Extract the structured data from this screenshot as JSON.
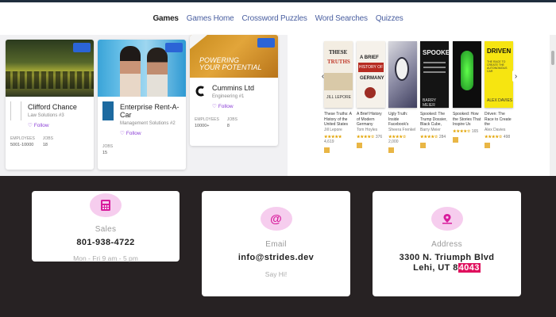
{
  "nav": {
    "items": [
      "Games",
      "Games Home",
      "Crossword Puzzles",
      "Word Searches",
      "Quizzes"
    ]
  },
  "jobs": [
    {
      "name": "Clifford Chance",
      "sub": "Law Solutions #3",
      "follow": "Follow",
      "stat1_label": "EMPLOYEES",
      "stat1_value": "5001-10000",
      "stat2_label": "JOBS",
      "stat2_value": "18"
    },
    {
      "name": "Enterprise Rent-A-Car",
      "sub": "Management Solutions #2",
      "follow": "Follow",
      "stat1_label": "JOBS",
      "stat1_value": "15"
    },
    {
      "name": "Cummins Ltd",
      "sub": "Engineering #1",
      "follow": "Follow",
      "stat1_label": "EMPLOYEES",
      "stat1_value": "10000+",
      "stat2_label": "JOBS",
      "stat2_value": "8",
      "banner_line1": "POWERING",
      "banner_line2": "YOUR POTENTIAL"
    }
  ],
  "books": [
    {
      "title": "These Truths: A History of the United States",
      "author": "Jill Lepore",
      "rating": "★★★★★",
      "count": "4,619"
    },
    {
      "title": "A Brief History of Modern Germany",
      "author": "Tom Hoyles",
      "rating": "★★★★☆",
      "count": "376"
    },
    {
      "title": "Ugly Truth: Inside Facebook's Battle for Domination",
      "author": "Sheera Frenkel",
      "rating": "★★★★☆",
      "count": "2,000"
    },
    {
      "title": "Spooked: The Trump Dossier, Black Cube, and the Rise of Private Spies",
      "author": "Barry Meier",
      "rating": "★★★★☆",
      "count": "284"
    },
    {
      "title": "Spooked: How the Stories That Inspire Us",
      "author": "",
      "rating": "★★★★☆",
      "count": "165"
    },
    {
      "title": "Driven: The Race to Create the Autonomous Car",
      "author": "Alex Davies",
      "rating": "★★★★☆",
      "count": "498"
    }
  ],
  "book_covers": [
    {
      "line1": "THESE",
      "line2": "TRUTHS",
      "line3": "JILL LEPORE"
    },
    {
      "line1": "A BRIEF",
      "line2": "HISTORY OF",
      "line3": "GERMANY"
    },
    {
      "line1": "",
      "line2": "",
      "line3": ""
    },
    {
      "line1": "SPOOKED",
      "line2": "",
      "line3": "BARRY MEIER"
    },
    {
      "line1": "",
      "line2": "",
      "line3": ""
    },
    {
      "line1": "DRIVEN",
      "line2": "THE RACE TO CREATE THE AUTONOMOUS CAR",
      "line3": "ALEX DAVIES"
    }
  ],
  "contact": {
    "sales": {
      "label": "Sales",
      "value": "801-938-4722",
      "note": "Mon - Fri 9 am - 5 pm"
    },
    "email": {
      "label": "Email",
      "value": "info@strides.dev",
      "note": "Say Hi!"
    },
    "address": {
      "label": "Address",
      "line1": "3300 N. Triumph Blvd",
      "line2_prefix": "Lehi, UT 8",
      "line2_highlight": "4043"
    }
  },
  "colors": {
    "accent": "#8b3fd6",
    "icon_bg": "#f6cdee",
    "icon": "#d81b9c",
    "dark_bg": "#272223",
    "highlight": "#e0105e"
  }
}
